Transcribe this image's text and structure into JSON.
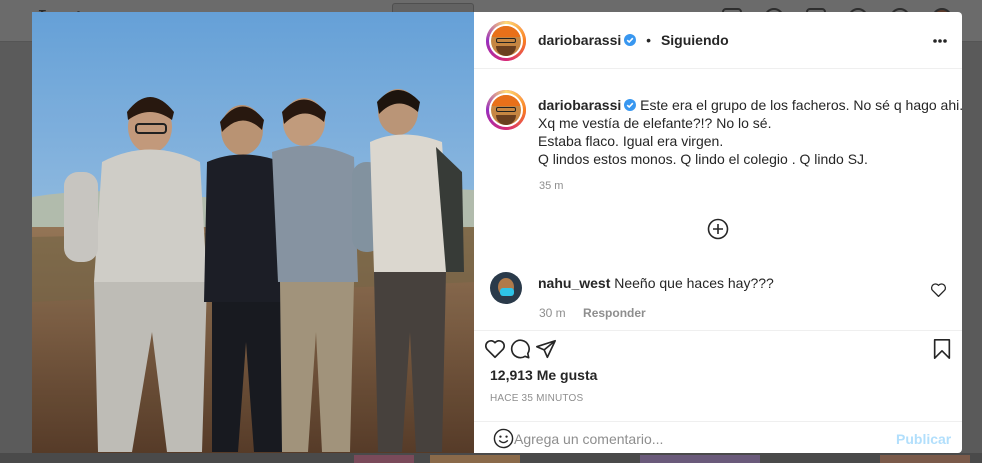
{
  "app": {
    "logo_text": "Instagram"
  },
  "post": {
    "author": "dariobarassi",
    "follow_status": "Siguiendo",
    "caption_lines": [
      "Este era el grupo de los facheros. No sé q hago ahi.",
      "Xq me vestía de elefante?!? No lo sé.",
      "Estaba flaco. Igual era virgen.",
      "Q lindos estos monos. Q lindo el colegio . Q lindo SJ."
    ],
    "caption_time": "35 m",
    "likes": "12,913 Me gusta",
    "posted_ago": "HACE 35 MINUTOS"
  },
  "comments": [
    {
      "user": "nahu_west",
      "text": "Neeño que haces hay???",
      "time": "30 m",
      "reply_label": "Responder"
    }
  ],
  "add_comment": {
    "placeholder": "Agrega un comentario...",
    "publish_label": "Publicar"
  },
  "icons": {
    "verified": "verified-badge-icon",
    "more": "more-options-icon",
    "load_more": "plus-circle-icon",
    "like": "heart-icon",
    "comment": "comment-icon",
    "share": "paper-plane-icon",
    "save": "bookmark-icon",
    "emoji": "emoji-icon"
  },
  "colors": {
    "verified": "#3897f0",
    "publish_disabled": "#b2dffc",
    "secondary_text": "#8e8e8e"
  }
}
